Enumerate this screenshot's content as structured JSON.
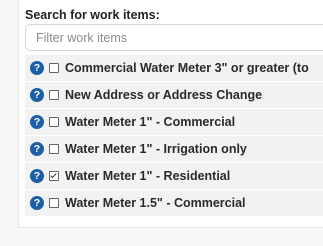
{
  "search": {
    "heading": "Search for work items:",
    "placeholder": "Filter work items",
    "value": ""
  },
  "items": [
    {
      "label": "Commercial Water Meter 3\" or greater (to",
      "checked": false
    },
    {
      "label": "New Address or Address Change",
      "checked": false
    },
    {
      "label": "Water Meter 1\" - Commercial",
      "checked": false
    },
    {
      "label": "Water Meter 1\" - Irrigation only",
      "checked": false
    },
    {
      "label": "Water Meter 1\" - Residential",
      "checked": true
    },
    {
      "label": "Water Meter 1.5\" - Commercial",
      "checked": false
    }
  ],
  "icons": {
    "help": "help-question-icon",
    "help_glyph": "?"
  },
  "colors": {
    "help_icon": "#1d5fa6",
    "row_background": "#f2f2f2"
  }
}
